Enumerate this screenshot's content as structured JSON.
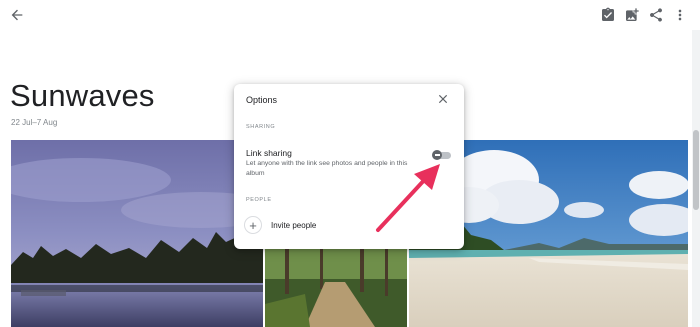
{
  "header": {
    "back_icon": "arrow-back-icon",
    "actions": [
      "add-to-album-icon",
      "add-photo-icon",
      "share-icon",
      "more-vert-icon"
    ]
  },
  "album": {
    "title": "Sunwaves",
    "dates": "22 Jul–7 Aug"
  },
  "dialog": {
    "title": "Options",
    "sharing_section": "SHARING",
    "link_sharing_title": "Link sharing",
    "link_sharing_desc": "Let anyone with the link see photos and people in this album",
    "link_sharing_enabled": false,
    "people_section": "PEOPLE",
    "invite_label": "Invite people"
  },
  "annotation": {
    "arrow_color": "#e8305c"
  },
  "colors": {
    "accent_arrow": "#e8305c",
    "icon_gray": "#5f6368"
  }
}
